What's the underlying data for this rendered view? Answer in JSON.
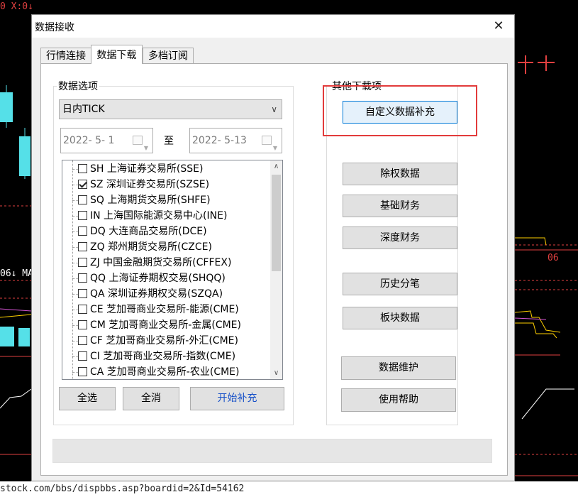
{
  "background": {
    "top_info": "0 X:0↓",
    "left_marker": "06↓ MA",
    "right_marker": "06",
    "status_url": "stock.com/bbs/dispbbs.asp?boardid=2&Id=54162"
  },
  "dialog": {
    "title": "数据接收",
    "close_icon": "✕",
    "tabs": [
      "行情连接",
      "数据下载",
      "多档订阅"
    ],
    "active_tab": "数据下载",
    "data_options": {
      "label": "数据选项",
      "type_selected": "日内TICK",
      "start_date": "2022-  5-  1",
      "to_label": "至",
      "end_date": "2022-  5-13",
      "markets": [
        {
          "label": "SH 上海证券交易所(SSE)",
          "checked": false
        },
        {
          "label": "SZ 深圳证券交易所(SZSE)",
          "checked": true
        },
        {
          "label": "SQ 上海期货交易所(SHFE)",
          "checked": false
        },
        {
          "label": "IN 上海国际能源交易中心(INE)",
          "checked": false
        },
        {
          "label": "DQ 大连商品交易所(DCE)",
          "checked": false
        },
        {
          "label": "ZQ 郑州期货交易所(CZCE)",
          "checked": false
        },
        {
          "label": "ZJ 中国金融期货交易所(CFFEX)",
          "checked": false
        },
        {
          "label": "QQ 上海证券期权交易(SHQQ)",
          "checked": false
        },
        {
          "label": "QA 深圳证券期权交易(SZQA)",
          "checked": false
        },
        {
          "label": "CE 芝加哥商业交易所-能源(CME)",
          "checked": false
        },
        {
          "label": "CM 芝加哥商业交易所-金属(CME)",
          "checked": false
        },
        {
          "label": "CF 芝加哥商业交易所-外汇(CME)",
          "checked": false
        },
        {
          "label": "CI 芝加哥商业交易所-指数(CME)",
          "checked": false
        },
        {
          "label": "CA 芝加哥商业交易所-农业(CME)",
          "checked": false
        }
      ],
      "select_all": "全选",
      "deselect_all": "全消",
      "start_fill": "开始补充"
    },
    "other_downloads": {
      "label": "其他下载项",
      "custom_fill": "自定义数据补充",
      "ex_rights": "除权数据",
      "basic_finance": "基础财务",
      "deep_finance": "深度财务",
      "history_ticks": "历史分笔",
      "sector_data": "板块数据",
      "data_maintenance": "数据维护",
      "help": "使用帮助"
    },
    "colors": {
      "highlight": "#e23b3b",
      "accent": "#0078d7",
      "link": "#1650c8"
    }
  }
}
